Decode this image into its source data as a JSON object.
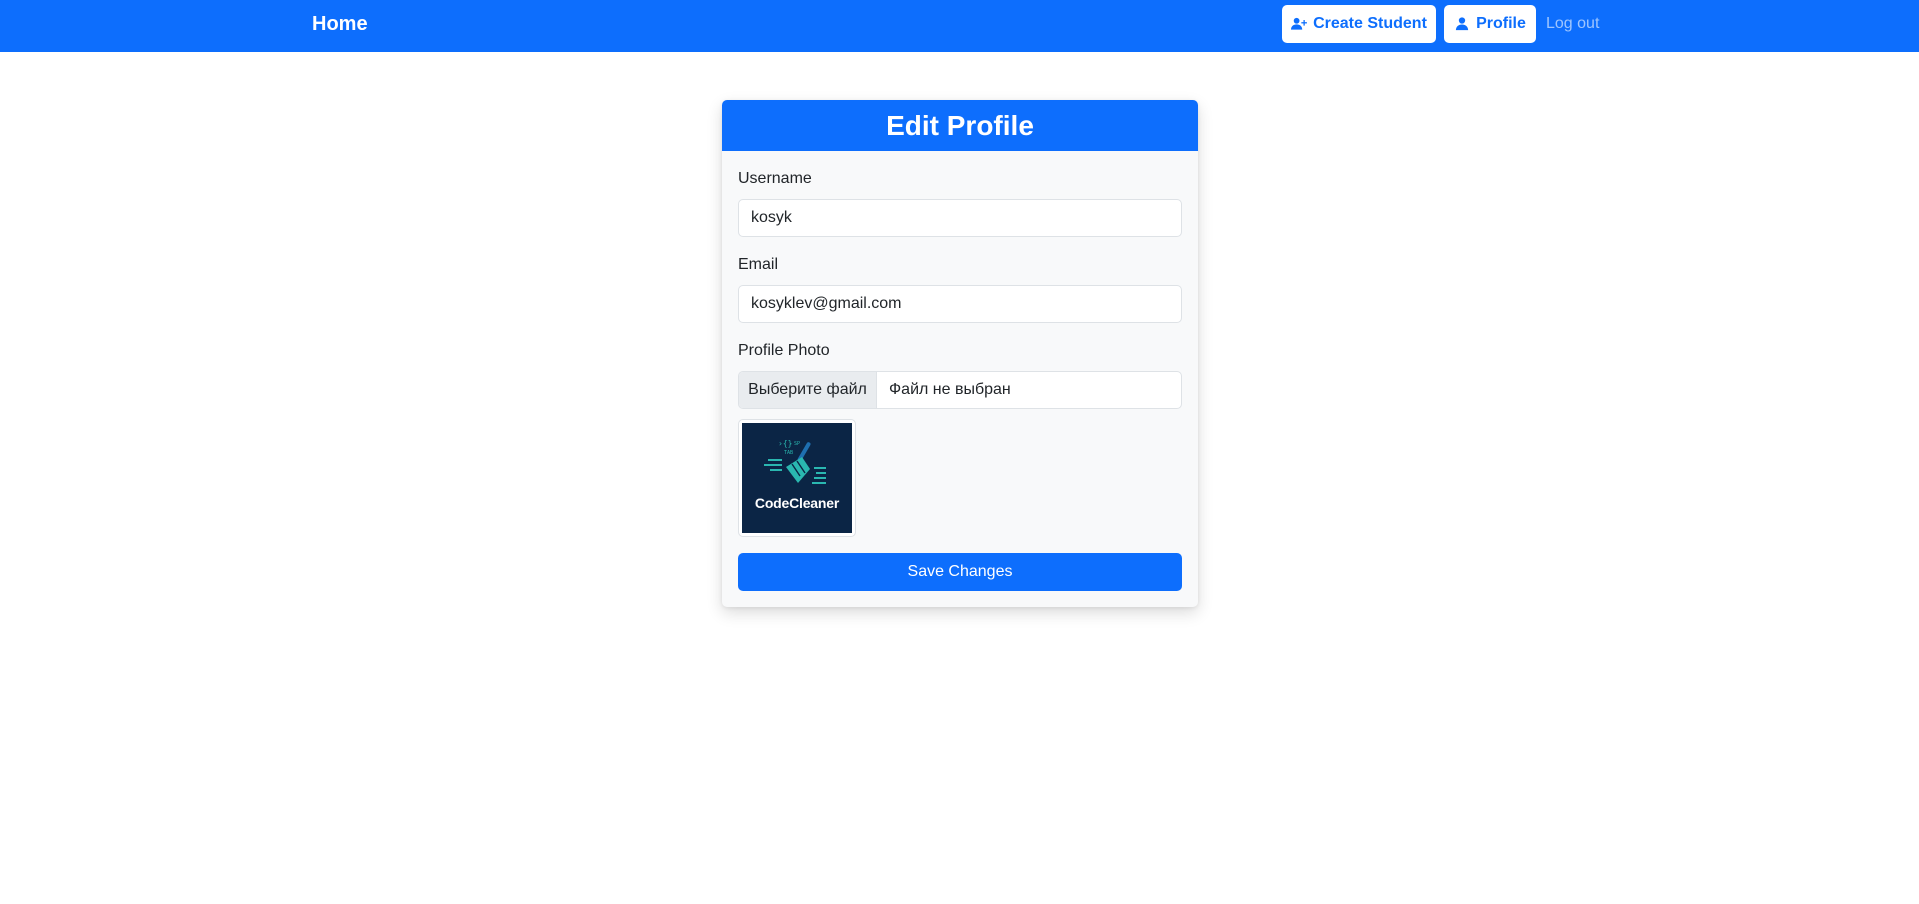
{
  "navbar": {
    "brand": "Home",
    "create_student": "Create Student",
    "profile": "Profile",
    "logout": "Log out"
  },
  "form": {
    "title": "Edit Profile",
    "username_label": "Username",
    "username_value": "kosyk",
    "email_label": "Email",
    "email_value": "kosyklev@gmail.com",
    "photo_label": "Profile Photo",
    "file_button": "Выберите файл",
    "file_status": "Файл не выбран",
    "photo_logo_text": "CodeCleaner",
    "save_label": "Save Changes"
  },
  "colors": {
    "primary": "#0d6efd",
    "logo_bg": "#0b2545",
    "logo_accent": "#2ab7b0"
  }
}
